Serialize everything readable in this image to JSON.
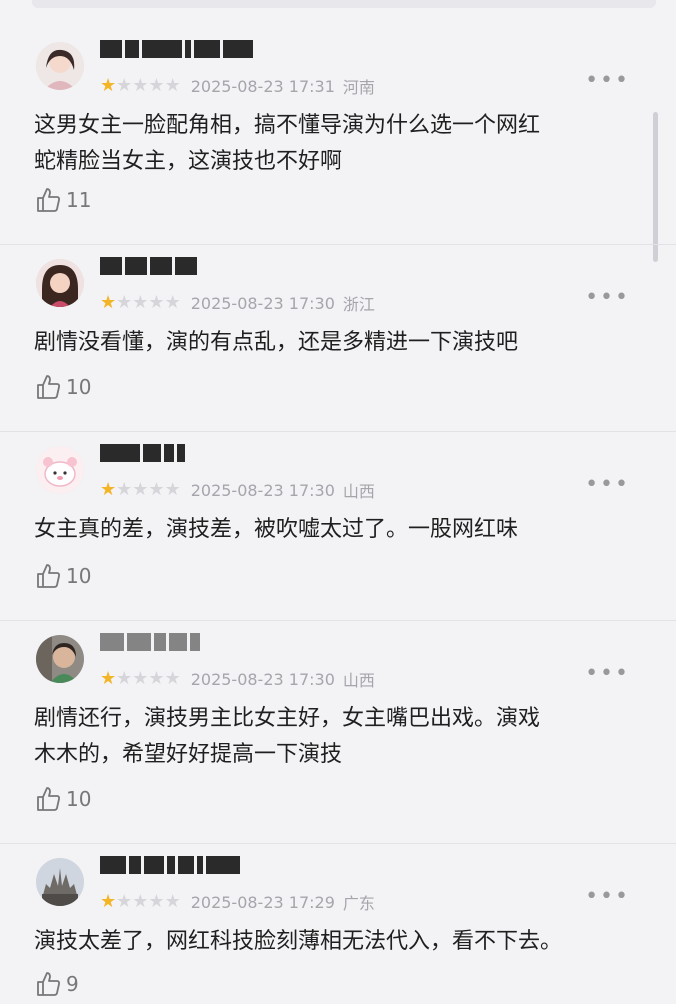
{
  "comments": [
    {
      "rating": 1,
      "timestamp": "2025-08-23 17:31",
      "region": "河南",
      "text_lines": [
        "这男女主一脸配角相，搞不懂导演为什么选一个网红",
        "蛇精脸当女主，这演技也不好啊"
      ],
      "likes": "11"
    },
    {
      "rating": 1,
      "timestamp": "2025-08-23 17:30",
      "region": "浙江",
      "text_lines": [
        "剧情没看懂，演的有点乱，还是多精进一下演技吧"
      ],
      "likes": "10"
    },
    {
      "rating": 1,
      "timestamp": "2025-08-23 17:30",
      "region": "山西",
      "text_lines": [
        "女主真的差，演技差，被吹嘘太过了。一股网红味"
      ],
      "likes": "10"
    },
    {
      "rating": 1,
      "timestamp": "2025-08-23 17:30",
      "region": "山西",
      "text_lines": [
        "剧情还行，演技男主比女主好，女主嘴巴出戏。演戏",
        "木木的，希望好好提高一下演技"
      ],
      "likes": "10"
    },
    {
      "rating": 1,
      "timestamp": "2025-08-23 17:29",
      "region": "广东",
      "text_lines": [
        "演技太差了，网红科技脸刻薄相无法代入，看不下去。"
      ],
      "likes": "9"
    }
  ],
  "colors": {
    "star_on": "#f3b425",
    "star_off": "#d6d6da",
    "meta": "#a5a5ab"
  },
  "icons": {
    "like": "thumbs-up-icon",
    "more": "more-dots-icon",
    "star": "star-icon"
  }
}
